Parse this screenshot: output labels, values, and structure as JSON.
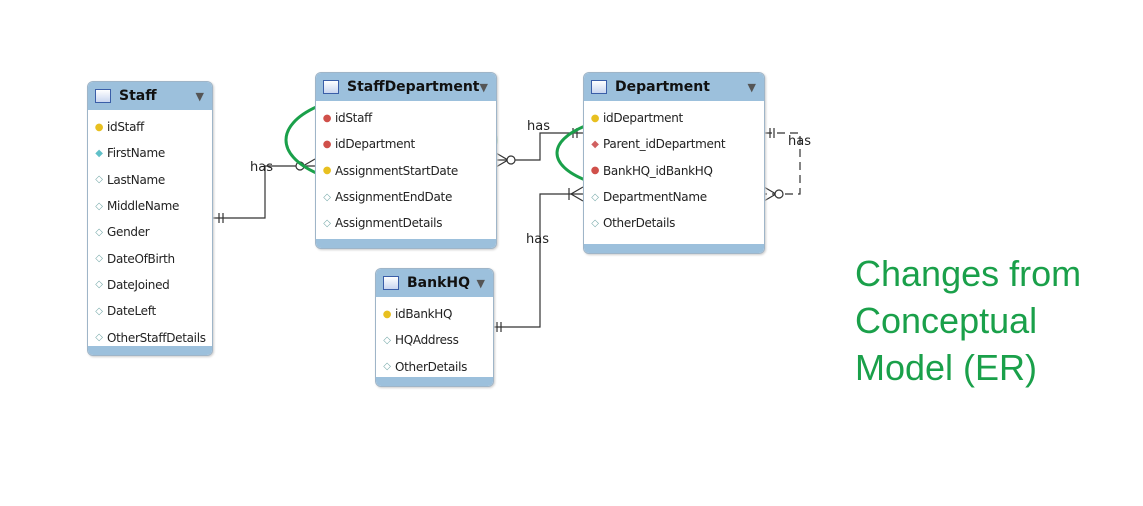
{
  "tables": {
    "staff": {
      "name": "Staff",
      "columns": [
        {
          "name": "idStaff",
          "icon": "pk-key"
        },
        {
          "name": "FirstName",
          "icon": "filled-diamond"
        },
        {
          "name": "LastName",
          "icon": "diamond"
        },
        {
          "name": "MiddleName",
          "icon": "diamond"
        },
        {
          "name": "Gender",
          "icon": "diamond"
        },
        {
          "name": "DateOfBirth",
          "icon": "diamond"
        },
        {
          "name": "DateJoined",
          "icon": "diamond"
        },
        {
          "name": "DateLeft",
          "icon": "diamond"
        },
        {
          "name": "OtherStaffDetails",
          "icon": "diamond"
        }
      ]
    },
    "staffdept": {
      "name": "StaffDepartment",
      "columns": [
        {
          "name": "idStaff",
          "icon": "fk-key"
        },
        {
          "name": "idDepartment",
          "icon": "fk-key"
        },
        {
          "name": "AssignmentStartDate",
          "icon": "pk-key"
        },
        {
          "name": "AssignmentEndDate",
          "icon": "diamond"
        },
        {
          "name": "AssignmentDetails",
          "icon": "diamond"
        }
      ]
    },
    "dept": {
      "name": "Department",
      "columns": [
        {
          "name": "idDepartment",
          "icon": "pk-key"
        },
        {
          "name": "Parent_idDepartment",
          "icon": "fk-diamond"
        },
        {
          "name": "BankHQ_idBankHQ",
          "icon": "fk-key"
        },
        {
          "name": "DepartmentName",
          "icon": "diamond"
        },
        {
          "name": "OtherDetails",
          "icon": "diamond"
        }
      ]
    },
    "bankhq": {
      "name": "BankHQ",
      "columns": [
        {
          "name": "idBankHQ",
          "icon": "pk-key"
        },
        {
          "name": "HQAddress",
          "icon": "diamond"
        },
        {
          "name": "OtherDetails",
          "icon": "diamond"
        }
      ]
    }
  },
  "relationships": {
    "staff_staffdept": "has",
    "staffdept_dept": "has",
    "bankhq_dept": "has",
    "dept_self": "has"
  },
  "note": {
    "line1": "Changes from",
    "line2": "Conceptual",
    "line3": "Model (ER)"
  },
  "colors": {
    "highlight": "#1aa04a",
    "header": "#9cc0dc"
  }
}
